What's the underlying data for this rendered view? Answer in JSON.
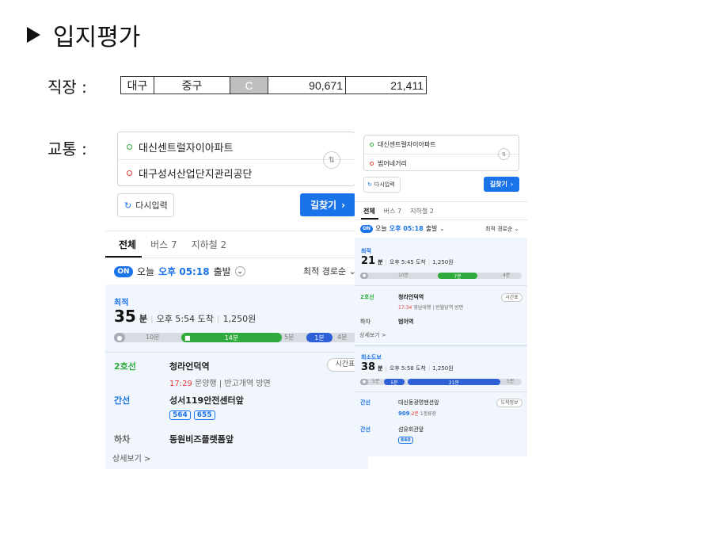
{
  "slide": {
    "title": "입지평가",
    "job_label": "직장 :",
    "traffic_label": "교통 :",
    "job_table": [
      "대구",
      "중구",
      "C",
      "90,671",
      "21,411"
    ]
  },
  "left": {
    "origin": "대신센트럴자이아파트",
    "destination": "대구성서산업단지관리공단",
    "retype": "다시입력",
    "search": "길찾기",
    "tabs": [
      "전체",
      "버스 7",
      "지하철 2"
    ],
    "on": "ON",
    "today": "오늘",
    "time": "오후 05:18",
    "depart": "출발",
    "sort": "최적 경로순",
    "route": {
      "tag": "최적",
      "minutes": "35",
      "min_unit": "분",
      "arrive": "오후 5:54 도착",
      "fare": "1,250원",
      "bar": {
        "walk1": "10분",
        "subway": "14분",
        "walk2": "5분",
        "bus": "1분",
        "walk3": "4분"
      },
      "steps": [
        {
          "line": "2호선",
          "place": "청라언덕역",
          "detail_time": "17:29",
          "detail_rest": "문양행 | 반고개역 방면",
          "pill": "시간표"
        },
        {
          "line": "간선",
          "place": "성서119안전센터앞",
          "buses": [
            "564",
            "655"
          ]
        },
        {
          "line": "하차",
          "place": "동원비즈플랫폼앞"
        }
      ],
      "more": "상세보기 >"
    }
  },
  "right": {
    "origin": "대신센트럴자이아파트",
    "destination": "범어네거리",
    "retype": "다시입력",
    "search": "길찾기",
    "tabs": [
      "전체",
      "버스 7",
      "지하철 2"
    ],
    "on": "ON",
    "today": "오늘",
    "time": "오후 05:18",
    "depart": "출발",
    "sort": "최적 경로순",
    "route1": {
      "tag": "최적",
      "minutes": "21",
      "min_unit": "분",
      "arrive": "오후 5:45 도착",
      "fare": "1,250원",
      "bar": {
        "walk1": "10분",
        "subway": "7분",
        "walk2": "4분"
      },
      "steps": [
        {
          "line": "2호선",
          "place": "청라언덕역",
          "detail_time": "17:34",
          "detail_rest": "영남대행 | 반월당역 방면",
          "pill": "시간표"
        },
        {
          "line": "하차",
          "place": "범어역"
        }
      ],
      "more": "상세보기 >"
    },
    "route2": {
      "tag": "최소도보",
      "minutes": "38",
      "min_unit": "분",
      "arrive": "오후 5:58 도착",
      "fare": "1,250원",
      "bar": {
        "walk1": "5분",
        "bus1": "5분",
        "bus2": "21분",
        "walk2": "5분"
      },
      "steps": [
        {
          "line": "간선",
          "place": "대신동광명맨션앞",
          "bus": "909",
          "eta": "2분",
          "eta_rest": "1정류장",
          "pill": "도착정보"
        },
        {
          "line": "간선",
          "place": "섬유회관앞",
          "buses": [
            "840"
          ]
        }
      ]
    }
  }
}
